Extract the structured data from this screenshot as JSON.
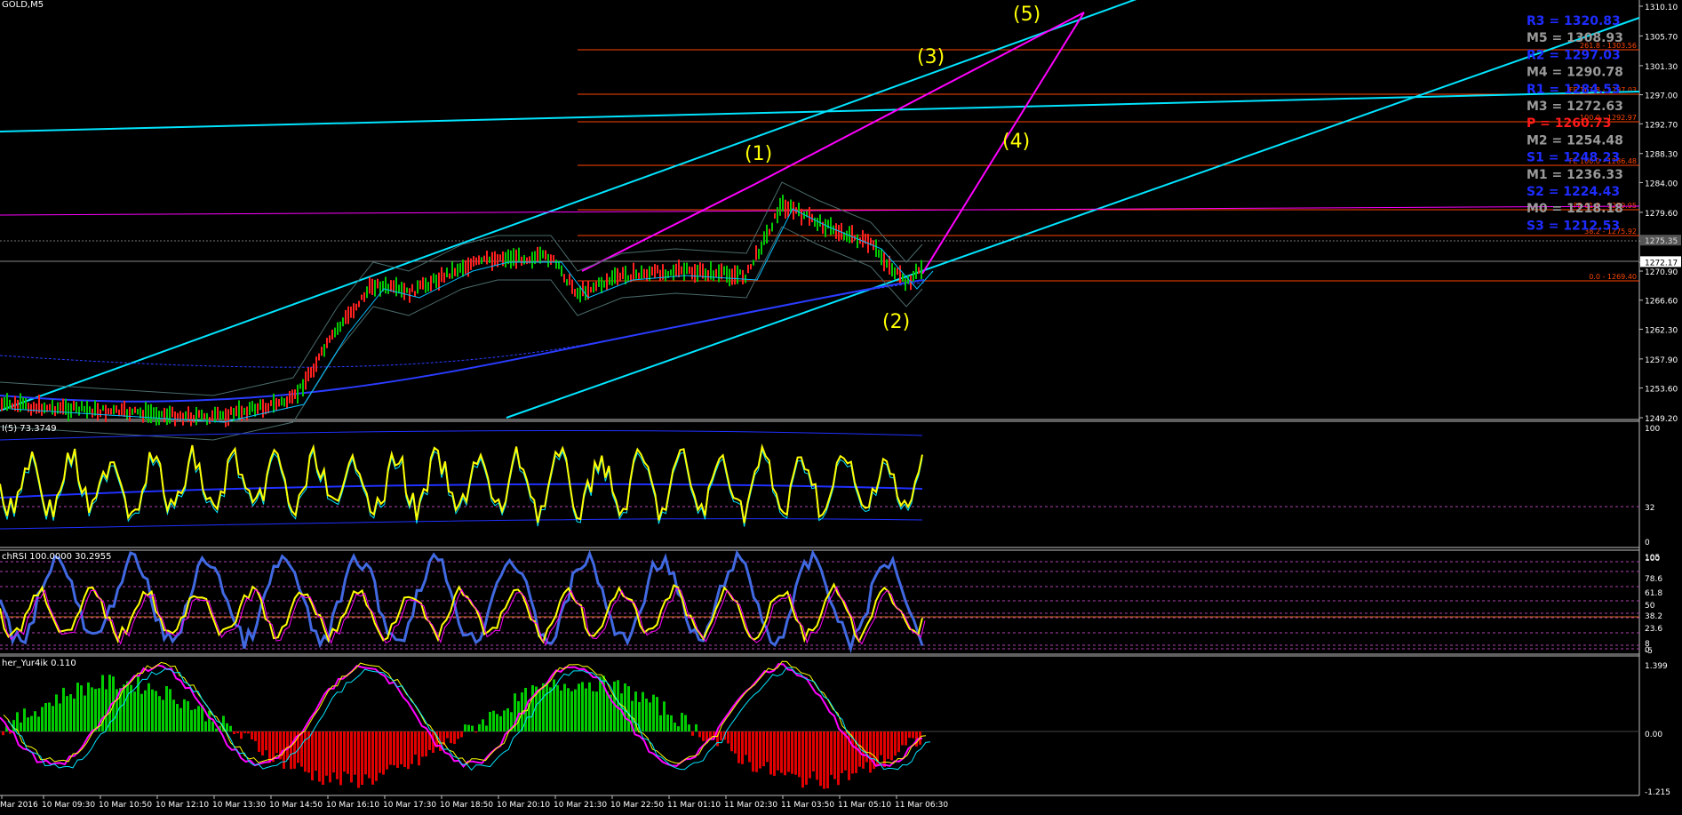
{
  "chart_data": {
    "type": "line",
    "symbol": "GOLD,M5",
    "indicators": {
      "rsi": {
        "label": "I(5) 73.3749",
        "levels": [
          "100",
          "32",
          "0"
        ]
      },
      "stochrsi": {
        "label": "chRSI 100.0000 30.2955",
        "levels": [
          "105",
          "100",
          "78.6",
          "61.8",
          "50",
          "38.2",
          "23.6",
          "8",
          "0",
          "-5"
        ]
      },
      "fisher": {
        "label": "her_Yur4ik 0.110",
        "levels": [
          "1.399",
          "0.00",
          "-1.215"
        ]
      }
    },
    "price_axis": [
      "1310.10",
      "1305.70",
      "1301.30",
      "1297.00",
      "1292.70",
      "1288.30",
      "1284.00",
      "1279.60",
      "1275.35",
      "1272.17",
      "1270.90",
      "1266.60",
      "1262.30",
      "1257.90",
      "1253.60",
      "1249.20"
    ],
    "price_tags": {
      "current": "1272.17",
      "upper": "1275.35"
    },
    "time_labels": [
      "Mar 2016",
      "10 Mar 09:30",
      "10 Mar 10:50",
      "10 Mar 12:10",
      "10 Mar 13:30",
      "10 Mar 14:50",
      "10 Mar 16:10",
      "10 Mar 17:30",
      "10 Mar 18:50",
      "10 Mar 20:10",
      "10 Mar 21:30",
      "10 Mar 22:50",
      "11 Mar 01:10",
      "11 Mar 02:30",
      "11 Mar 03:50",
      "11 Mar 05:10",
      "11 Mar 06:30"
    ],
    "wave_labels": [
      "(1)",
      "(2)",
      "(3)",
      "(4)",
      "(5)"
    ],
    "pivots": [
      {
        "text": "R3 = 1320.83",
        "color": "#1e2cff"
      },
      {
        "text": "M5 = 1308.93",
        "color": "#9a9a9a"
      },
      {
        "text": "R2 = 1297.03",
        "color": "#1e2cff"
      },
      {
        "text": "M4 = 1290.78",
        "color": "#9a9a9a"
      },
      {
        "text": "R1 = 1284.53",
        "color": "#1e2cff"
      },
      {
        "text": "M3 = 1272.63",
        "color": "#9a9a9a"
      },
      {
        "text": "P   = 1260.73",
        "color": "#ff1a1a"
      },
      {
        "text": "M2 = 1254.48",
        "color": "#9a9a9a"
      },
      {
        "text": "S1 = 1248.23",
        "color": "#1e2cff"
      },
      {
        "text": "M1 = 1236.33",
        "color": "#9a9a9a"
      },
      {
        "text": "S2 = 1224.43",
        "color": "#1e2cff"
      },
      {
        "text": "M0 = 1218.18",
        "color": "#9a9a9a"
      },
      {
        "text": "S3 = 1212.53",
        "color": "#1e2cff"
      }
    ],
    "fib_labels": [
      "261.8 - 1303.56",
      "FE 161.8 - 1297.03",
      "100.0 - 1292.97",
      "FE 100.0 - 1286.48",
      "FE 61.8 - 1279.95",
      "38.2 - 1275.92",
      "0.0 - 1269.40"
    ],
    "colors": {
      "background": "#000000",
      "channel": "#00e5ff",
      "wave": "#ff00ff",
      "fib": "#ff4500",
      "rsi": "#ffff00",
      "stoch": "#4169e1",
      "hist_up": "#00cc00",
      "hist_down": "#e00000",
      "wave_text": "#ffff00"
    }
  }
}
